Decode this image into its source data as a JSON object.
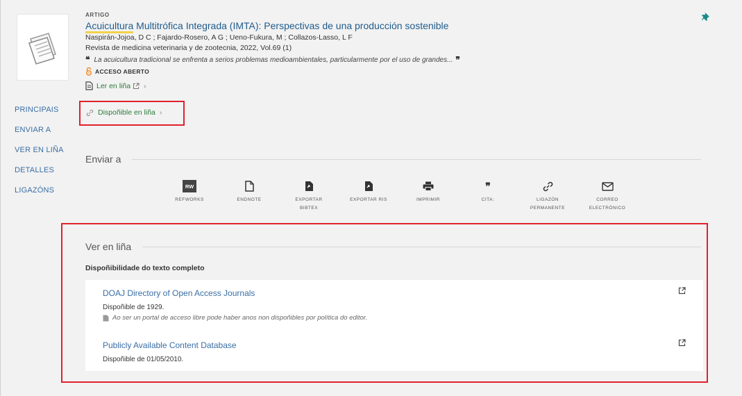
{
  "record": {
    "type": "ARTIGO",
    "title_highlight": "Acuicultura",
    "title_rest": " Multitrófica Integrada (IMTA): Perspectivas de una producción sostenible",
    "authors": "Naspirán-Jojoa, D C ; Fajardo-Rosero, A G ; Ueno-Fukura, M ; Collazos-Lasso, L F",
    "source": "Revista de medicina veterinaria y de zootecnia, 2022, Vol.69 (1)",
    "abstract": "La acuicultura tradicional se enfrenta a serios problemas medioambientales, particularmente por el uso de grandes...",
    "open_access": "ACCESO ABERTO",
    "read_online": "Ler en liña",
    "available_online": "Dispoñible en liña"
  },
  "nav": {
    "items": [
      "PRINCIPAIS",
      "ENVIAR A",
      "VER EN LIÑA",
      "DETALLES",
      "LIGAZÓNS"
    ]
  },
  "send_to": {
    "title": "Enviar a",
    "items": [
      {
        "label": "REFWORKS",
        "icon": "refworks-icon"
      },
      {
        "label": "ENDNOTE",
        "icon": "document-icon"
      },
      {
        "label": "EXPORTAR\nBIBTEX",
        "icon": "export-file-icon"
      },
      {
        "label": "EXPORTAR RIS",
        "icon": "export-file-icon"
      },
      {
        "label": "IMPRIMIR",
        "icon": "print-icon"
      },
      {
        "label": "CITA:",
        "icon": "quote-icon"
      },
      {
        "label": "LIGAZÓN\nPERMANENTE",
        "icon": "link-icon"
      },
      {
        "label": "CORREO\nELECTRÓNICO",
        "icon": "mail-icon"
      }
    ],
    "rw_text": "RW"
  },
  "view_online": {
    "title": "Ver en liña",
    "subtitle": "Dispoñibilidade do texto completo",
    "sources": [
      {
        "name": "DOAJ Directory of Open Access Journals",
        "date": "Dispoñible de 1929.",
        "note": "Ao ser un portal de acceso libre pode haber anos non dispoñibles por política do editor."
      },
      {
        "name": "Publicly Available Content Database",
        "date": "Dispoñible de 01/05/2010."
      }
    ]
  },
  "colors": {
    "link": "#3a6ea5",
    "title": "#1f5b8c",
    "green": "#2a7a3a",
    "highlight": "#e0202b",
    "oa": "#f08a24"
  }
}
